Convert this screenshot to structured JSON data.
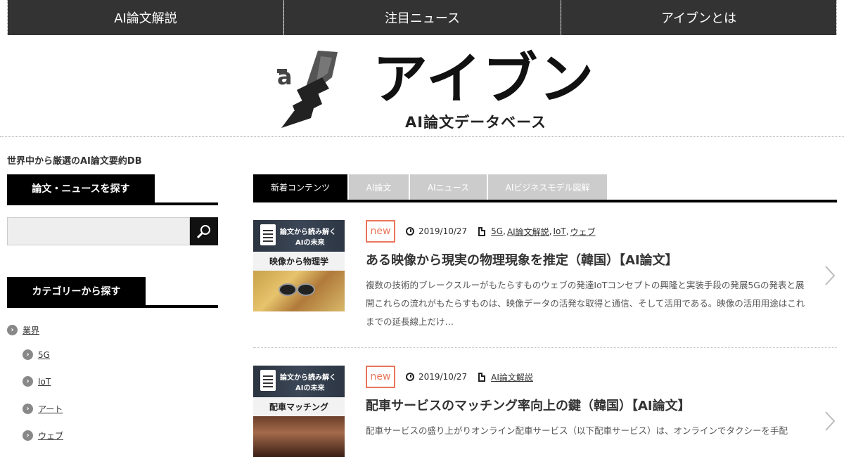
{
  "nav": {
    "items": [
      {
        "label": "AI論文解説"
      },
      {
        "label": "注目ニュース"
      },
      {
        "label": "アイブンとは"
      }
    ]
  },
  "header": {
    "logo_text": "アイブン",
    "logo_subtitle": "AI論文データベース",
    "tagline": "世界中から厳選のAI論文要約DB"
  },
  "sidebar": {
    "search": {
      "heading": "論文・ニュースを探す",
      "value": "",
      "placeholder": "",
      "button_icon": "search-icon"
    },
    "categories": {
      "heading": "カテゴリーから探す",
      "items": [
        {
          "label": "業界",
          "level": 0
        },
        {
          "label": "5G",
          "level": 1
        },
        {
          "label": "IoT",
          "level": 1
        },
        {
          "label": "アート",
          "level": 1
        },
        {
          "label": "ウェブ",
          "level": 1
        }
      ]
    }
  },
  "tabs": [
    {
      "label": "新着コンテンツ",
      "active": true
    },
    {
      "label": "AI論文",
      "active": false
    },
    {
      "label": "AIニュース",
      "active": false
    },
    {
      "label": "AIビジネスモデル図解",
      "active": false
    }
  ],
  "articles": [
    {
      "thumb_line1": "論文から読み解く",
      "thumb_line2": "AIの未来",
      "thumb_caption": "映像から物理学",
      "badge": "new",
      "date": "2019/10/27",
      "tags": [
        "5G",
        "AI論文解説",
        "IoT",
        "ウェブ"
      ],
      "title": "ある映像から現実の物理現象を推定（韓国）【AI論文】",
      "excerpt": "複数の技術的ブレークスルーがもたらすものウェブの発達IoTコンセプトの興隆と実装手段の発展5Gの発表と展開これらの流れがもたらすものは、映像データの活発な取得と通信、そして活用である。映像の活用用途はこれまでの延長線上だけ…"
    },
    {
      "thumb_line1": "論文から読み解く",
      "thumb_line2": "AIの未来",
      "thumb_caption": "配車マッチング",
      "badge": "new",
      "date": "2019/10/27",
      "tags": [
        "AI論文解説"
      ],
      "title": "配車サービスのマッチング率向上の鍵（韓国）【AI論文】",
      "excerpt": "配車サービスの盛り上がりオンライン配車サービス（以下配車サービス）は、オンラインでタクシーを手配"
    }
  ],
  "colors": {
    "nav_bg": "#333333",
    "badge_new": "#e9765a",
    "tab_active": "#000000",
    "tab_inactive": "#cccccc"
  }
}
